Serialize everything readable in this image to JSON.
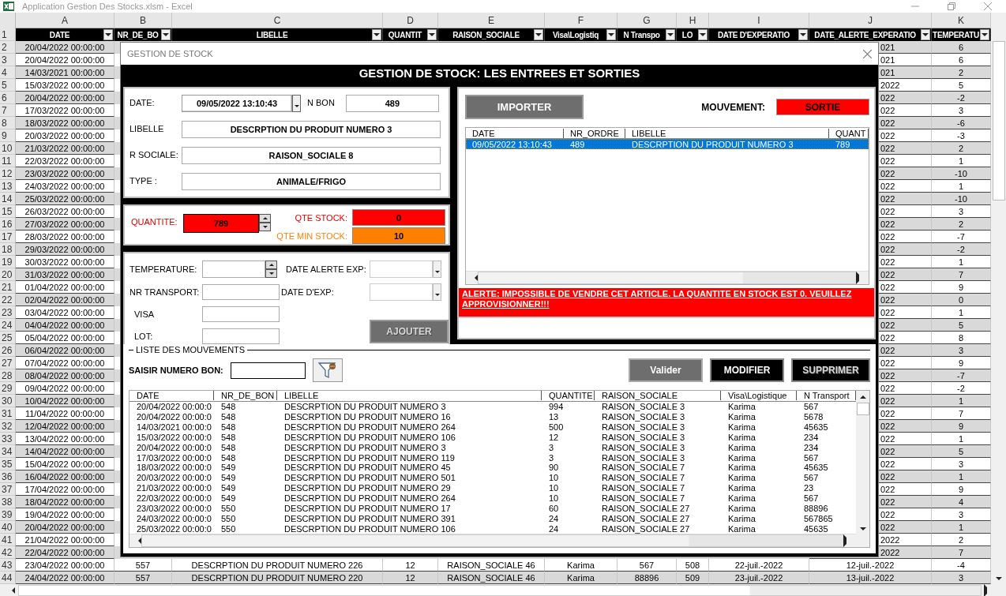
{
  "window": {
    "title": "Application Gestion Des Stocks.xlsm - Excel"
  },
  "sheet": {
    "column_letters": [
      "A",
      "B",
      "C",
      "D",
      "E",
      "F",
      "G",
      "H",
      "I",
      "J",
      "K"
    ],
    "header_row": {
      "number": "1",
      "headings": [
        "DATE",
        "NR_DE_BO",
        "LIBELLE",
        "QUANTIT",
        "RAISON_SOCIALE",
        "Visa\\Logistiq",
        "N Transpo",
        "LO",
        "DATE D'EXPERATIO",
        "DATE_ALERTE_EXPERATIO",
        "TEMPERATU"
      ]
    },
    "rows": [
      {
        "number": "2",
        "date": "20/04/2022 00:00:00",
        "col_j": "021",
        "temperature": "6"
      },
      {
        "number": "3",
        "date": "20/04/2022 00:00:00",
        "col_j": "021",
        "temperature": "6"
      },
      {
        "number": "4",
        "date": "14/03/2021 00:00:00",
        "col_j": "021",
        "temperature": "2"
      },
      {
        "number": "5",
        "date": "15/03/2022 00:00:00",
        "col_j": "2022",
        "temperature": "5"
      },
      {
        "number": "6",
        "date": "20/04/2022 00:00:00",
        "col_j": "022",
        "temperature": "-2"
      },
      {
        "number": "7",
        "date": "17/03/2022 00:00:00",
        "col_j": "022",
        "temperature": "3"
      },
      {
        "number": "8",
        "date": "18/03/2022 00:00:00",
        "col_j": "022",
        "temperature": "-6"
      },
      {
        "number": "9",
        "date": "20/03/2022 00:00:00",
        "col_j": "022",
        "temperature": "-3"
      },
      {
        "number": "10",
        "date": "21/03/2022 00:00:00",
        "col_j": "022",
        "temperature": "2"
      },
      {
        "number": "11",
        "date": "22/03/2022 00:00:00",
        "col_j": "022",
        "temperature": "1"
      },
      {
        "number": "12",
        "date": "23/03/2022 00:00:00",
        "col_j": "022",
        "temperature": "-10"
      },
      {
        "number": "13",
        "date": "24/03/2022 00:00:00",
        "col_j": "022",
        "temperature": "1"
      },
      {
        "number": "14",
        "date": "25/03/2022 00:00:00",
        "col_j": "022",
        "temperature": "-10"
      },
      {
        "number": "15",
        "date": "26/03/2022 00:00:00",
        "col_j": "022",
        "temperature": "3"
      },
      {
        "number": "16",
        "date": "27/03/2022 00:00:00",
        "col_j": "022",
        "temperature": "2"
      },
      {
        "number": "17",
        "date": "28/03/2022 00:00:00",
        "col_j": "022",
        "temperature": "-7"
      },
      {
        "number": "18",
        "date": "29/03/2022 00:00:00",
        "col_j": "022",
        "temperature": "-2"
      },
      {
        "number": "19",
        "date": "30/03/2022 00:00:00",
        "col_j": "022",
        "temperature": "1"
      },
      {
        "number": "20",
        "date": "31/03/2022 00:00:00",
        "col_j": "022",
        "temperature": "7"
      },
      {
        "number": "21",
        "date": "01/04/2022 00:00:00",
        "col_j": "022",
        "temperature": "9"
      },
      {
        "number": "22",
        "date": "02/04/2022 00:00:00",
        "col_j": "022",
        "temperature": "0"
      },
      {
        "number": "23",
        "date": "03/04/2022 00:00:00",
        "col_j": "022",
        "temperature": "1"
      },
      {
        "number": "24",
        "date": "04/04/2022 00:00:00",
        "col_j": "022",
        "temperature": "5"
      },
      {
        "number": "25",
        "date": "05/04/2022 00:00:00",
        "col_j": "022",
        "temperature": "8"
      },
      {
        "number": "26",
        "date": "06/04/2022 00:00:00",
        "col_j": "022",
        "temperature": "3"
      },
      {
        "number": "27",
        "date": "07/04/2022 00:00:00",
        "col_j": "022",
        "temperature": "9"
      },
      {
        "number": "28",
        "date": "08/04/2022 00:00:00",
        "col_j": "022",
        "temperature": "-7"
      },
      {
        "number": "29",
        "date": "09/04/2022 00:00:00",
        "col_j": "022",
        "temperature": "-2"
      },
      {
        "number": "30",
        "date": "10/04/2022 00:00:00",
        "col_j": "022",
        "temperature": "1"
      },
      {
        "number": "31",
        "date": "11/04/2022 00:00:00",
        "col_j": "022",
        "temperature": "7"
      },
      {
        "number": "32",
        "date": "12/04/2022 00:00:00",
        "col_j": "022",
        "temperature": "9"
      },
      {
        "number": "33",
        "date": "13/04/2022 00:00:00",
        "col_j": "022",
        "temperature": "1"
      },
      {
        "number": "34",
        "date": "14/04/2022 00:00:00",
        "col_j": "022",
        "temperature": "5"
      },
      {
        "number": "35",
        "date": "15/04/2022 00:00:00",
        "col_j": "022",
        "temperature": "3"
      },
      {
        "number": "36",
        "date": "16/04/2022 00:00:00",
        "col_j": "022",
        "temperature": "1"
      },
      {
        "number": "37",
        "date": "17/04/2022 00:00:00",
        "col_j": "022",
        "temperature": "9"
      },
      {
        "number": "38",
        "date": "18/04/2022 00:00:00",
        "col_j": "022",
        "temperature": "4"
      },
      {
        "number": "39",
        "date": "19/04/2022 00:00:00",
        "col_j": "022",
        "temperature": "3"
      },
      {
        "number": "40",
        "date": "20/04/2022 00:00:00",
        "col_j": "022",
        "temperature": "1"
      },
      {
        "number": "41",
        "date": "21/04/2022 00:00:00",
        "col_j": "2022",
        "temperature": "2"
      },
      {
        "number": "42",
        "date": "22/04/2022 00:00:00",
        "col_j": "2022",
        "temperature": "7"
      }
    ],
    "full_rows": [
      {
        "number": "43",
        "cells": [
          "23/04/2022 00:00:00",
          "557",
          "DESCRPTION DU PRODUIT NUMERO 226",
          "12",
          "RAISON_SOCIALE 46",
          "Karima",
          "567",
          "508",
          "22-juil.-2022",
          "12-juil.-2022",
          "-4"
        ]
      },
      {
        "number": "44",
        "cells": [
          "24/04/2022 00:00:00",
          "557",
          "DESCRPTION DU PRODUIT NUMERO 220",
          "12",
          "RAISON_SOCIALE 46",
          "Karima",
          "88896",
          "509",
          "23-juil.-2022",
          "13-juil.-2022",
          "3"
        ]
      }
    ]
  },
  "dialog": {
    "title": "GESTION DE STOCK",
    "heading": "GESTION DE STOCK: LES ENTREES ET SORTIES",
    "date": {
      "label": "DATE:",
      "value": "09/05/2022 13:10:43"
    },
    "n_bon": {
      "label": "N BON",
      "value": "489"
    },
    "details": [
      {
        "label": "LIBELLE",
        "value": "DESCRPTION DU PRODUIT NUMERO 3"
      },
      {
        "label": "R SOCIALE:",
        "value": "RAISON_SOCIALE 8"
      },
      {
        "label": "TYPE :",
        "value": "ANIMALE/FRIGO"
      }
    ],
    "quantity": {
      "label": "QUANTITE:",
      "value": "789"
    },
    "qte_stock": {
      "label": "QTE STOCK:",
      "value": "0"
    },
    "qte_min_stock": {
      "label": "QTE MIN STOCK:",
      "value": "10"
    },
    "temperature": {
      "label": "TEMPERATURE:"
    },
    "nr_transport": {
      "label": "NR TRANSPORT:"
    },
    "visa": {
      "label": "VISA"
    },
    "lot": {
      "label": "LOT:"
    },
    "date_alerte_exp": {
      "label": "DATE ALERTE EXP:"
    },
    "date_exp": {
      "label": "DATE D'EXP:"
    },
    "add_button": {
      "label": "AJOUTER",
      "disabled": true
    },
    "import_button": {
      "label": "IMPORTER"
    },
    "movement": {
      "label": "MOUVEMENT:",
      "value": "SORTIE"
    },
    "movement_list": {
      "columns": [
        "DATE",
        "NR_ORDRE",
        "LIBELLE",
        "QUANT"
      ],
      "rows": [
        {
          "cells": [
            "09/05/2022 13:10:43",
            "489",
            "DESCRPTION DU PRODUIT NUMERO 3",
            "789"
          ],
          "selected": true
        }
      ]
    },
    "alert": "ALERTE: IMPOSSIBLE DE VENDRE CET ARTICLE. LA QUANTITE EN STOCK EST 0. VEUILLEZ APPROVISIONNER!!!",
    "history": {
      "legend": "LISTE DES MOUVEMENTS",
      "search_label": "SAISIR NUMERO BON:",
      "actions": [
        {
          "label": "Valider",
          "kind": "secondary",
          "disabled": false
        },
        {
          "label": "MODIFIER",
          "kind": "primary",
          "disabled": false
        },
        {
          "label": "SUPPRIMER",
          "kind": "primary",
          "disabled": true
        }
      ],
      "columns": [
        "DATE",
        "NR_DE_BON",
        "LIBELLE",
        "QUANTITE",
        "RAISON_SOCIALE",
        "Visa\\Logistique",
        "N Transport"
      ],
      "rows": [
        {
          "cells": [
            "20/04/2022 00:00:0",
            "548",
            "DESCRPTION DU PRODUIT NUMERO 3",
            "994",
            "RAISON_SOCIALE 3",
            "Karima",
            "567"
          ],
          "selected": false
        },
        {
          "cells": [
            "20/04/2022 00:00:0",
            "548",
            "DESCRPTION DU PRODUIT NUMERO 16",
            "13",
            "RAISON_SOCIALE 3",
            "Karima",
            "5678"
          ],
          "selected": false
        },
        {
          "cells": [
            "14/03/2021 00:00:0",
            "548",
            "DESCRPTION DU PRODUIT NUMERO 264",
            "500",
            "RAISON_SOCIALE 3",
            "Karima",
            "45635"
          ],
          "selected": false
        },
        {
          "cells": [
            "15/03/2022 00:00:0",
            "548",
            "DESCRPTION DU PRODUIT NUMERO 106",
            "12",
            "RAISON_SOCIALE 3",
            "Karima",
            "234"
          ],
          "selected": false
        },
        {
          "cells": [
            "20/04/2022 00:00:0",
            "548",
            "DESCRPTION DU PRODUIT NUMERO 3",
            "3",
            "RAISON_SOCIALE 3",
            "Karima",
            "234"
          ],
          "selected": false
        },
        {
          "cells": [
            "17/03/2022 00:00:0",
            "548",
            "DESCRPTION DU PRODUIT NUMERO 119",
            "3",
            "RAISON_SOCIALE 3",
            "Karima",
            "567"
          ],
          "selected": false
        },
        {
          "cells": [
            "18/03/2022 00:00:0",
            "549",
            "DESCRPTION DU PRODUIT NUMERO 45",
            "90",
            "RAISON_SOCIALE 7",
            "Karima",
            "45635"
          ],
          "selected": false
        },
        {
          "cells": [
            "20/03/2022 00:00:0",
            "549",
            "DESCRPTION DU PRODUIT NUMERO 501",
            "10",
            "RAISON_SOCIALE 7",
            "Karima",
            "567"
          ],
          "selected": false
        },
        {
          "cells": [
            "21/03/2022 00:00:0",
            "549",
            "DESCRPTION DU PRODUIT NUMERO 29",
            "10",
            "RAISON_SOCIALE 7",
            "Karima",
            "23"
          ],
          "selected": false
        },
        {
          "cells": [
            "22/03/2022 00:00:0",
            "549",
            "DESCRPTION DU PRODUIT NUMERO 264",
            "10",
            "RAISON_SOCIALE 7",
            "Karima",
            "567"
          ],
          "selected": false
        },
        {
          "cells": [
            "23/03/2022 00:00:0",
            "550",
            "DESCRPTION DU PRODUIT NUMERO 17",
            "60",
            "RAISON_SOCIALE 27",
            "Karima",
            "88896"
          ],
          "selected": false
        },
        {
          "cells": [
            "24/03/2022 00:00:0",
            "550",
            "DESCRPTION DU PRODUIT NUMERO 391",
            "24",
            "RAISON_SOCIALE 27",
            "Karima",
            "567865"
          ],
          "selected": false
        },
        {
          "cells": [
            "25/03/2022 00:00:0",
            "550",
            "DESCRPTION DU PRODUIT NUMERO 106",
            "24",
            "RAISON_SOCIALE 27",
            "Karima",
            "45635"
          ],
          "selected": false
        }
      ]
    }
  }
}
